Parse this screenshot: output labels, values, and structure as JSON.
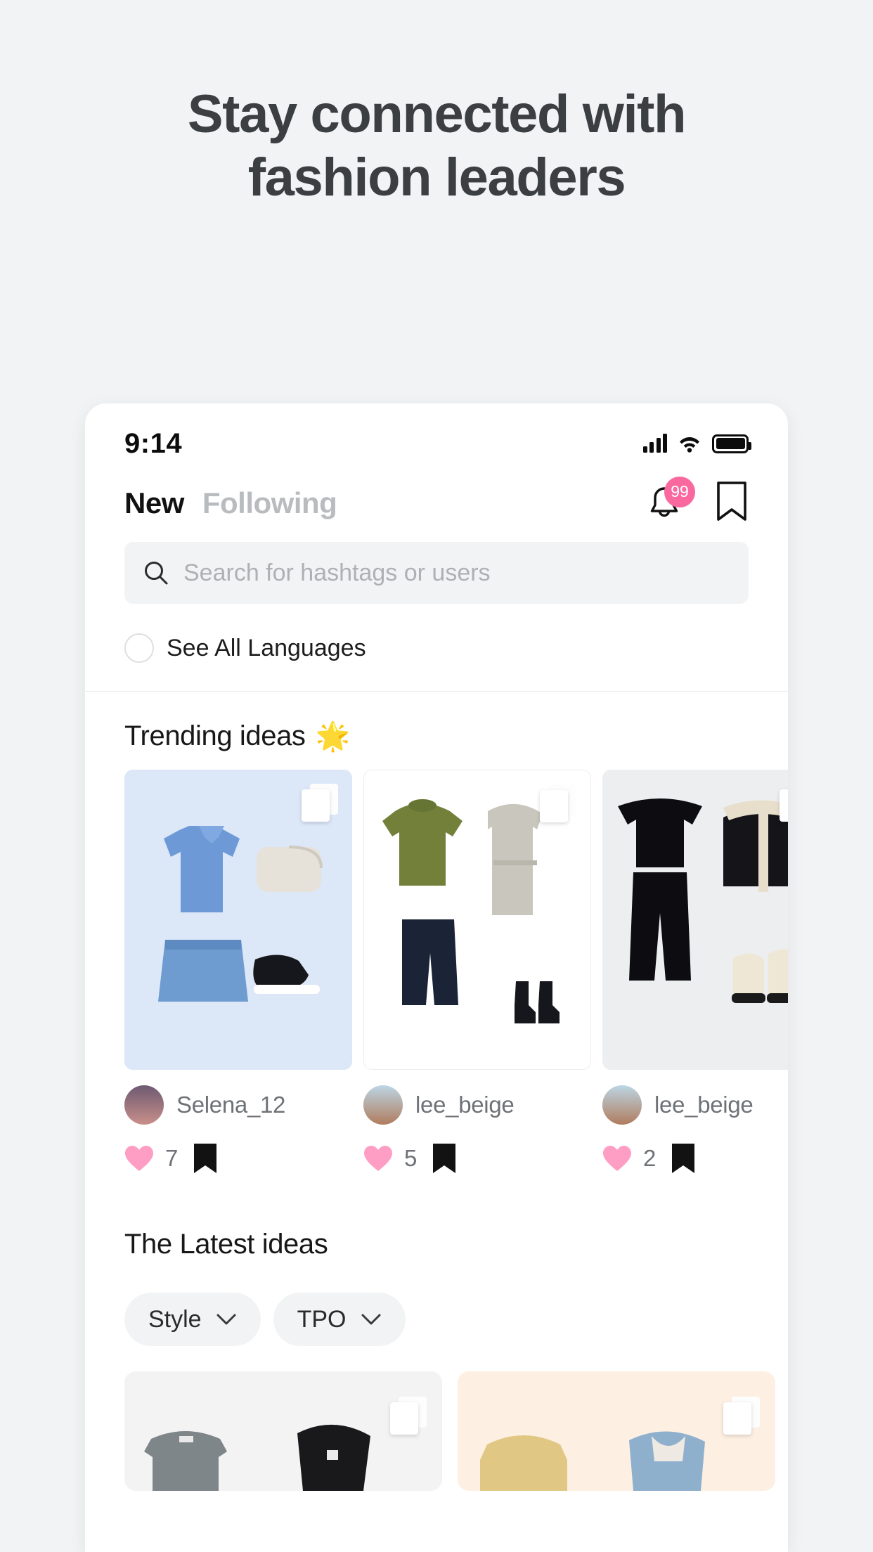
{
  "promo": {
    "headline_line1": "Stay connected with",
    "headline_line2": "fashion leaders"
  },
  "status_bar": {
    "time": "9:14",
    "signal_icon": "cellular-signal-icon",
    "wifi_icon": "wifi-icon",
    "battery_icon": "battery-full-icon"
  },
  "header": {
    "tabs": [
      {
        "label": "New",
        "active": true
      },
      {
        "label": "Following",
        "active": false
      }
    ],
    "notification_icon": "bell-icon",
    "notification_badge": "99",
    "bookmark_icon": "bookmark-outline-icon",
    "badge_color": "#f9699f"
  },
  "search": {
    "placeholder": "Search for hashtags or users",
    "value": "",
    "icon": "search-icon"
  },
  "language_filter": {
    "label": "See All Languages",
    "checked": false,
    "icon": "radio-circle-icon"
  },
  "trending": {
    "title": "Trending ideas",
    "emoji": "🌟",
    "cards": [
      {
        "username": "Selena_12",
        "likes": "7",
        "bg": "#dce7f8",
        "save_icon": "stack-copy-icon",
        "like_icon": "heart-icon",
        "bookmark_icon": "bookmark-filled-icon"
      },
      {
        "username": "lee_beige",
        "likes": "5",
        "bg": "#ffffff",
        "save_icon": "stack-copy-icon",
        "like_icon": "heart-icon",
        "bookmark_icon": "bookmark-filled-icon"
      },
      {
        "username": "lee_beige",
        "likes": "2",
        "bg": "#eceef0",
        "save_icon": "stack-copy-icon",
        "like_icon": "heart-icon",
        "bookmark_icon": "bookmark-filled-icon"
      }
    ]
  },
  "latest": {
    "title": "The Latest ideas",
    "filters": [
      {
        "label": "Style",
        "icon": "chevron-down-icon"
      },
      {
        "label": "TPO",
        "icon": "chevron-down-icon"
      }
    ],
    "cards": [
      {
        "bg": "#f3f3f3",
        "save_icon": "stack-copy-icon"
      },
      {
        "bg": "#fdf0e3",
        "save_icon": "stack-copy-icon"
      }
    ]
  },
  "colors": {
    "page_bg": "#f1f3f5",
    "accent_pink": "#f9699f",
    "heart_pink": "#ff9ec4",
    "text_dark": "#3b3f42"
  }
}
